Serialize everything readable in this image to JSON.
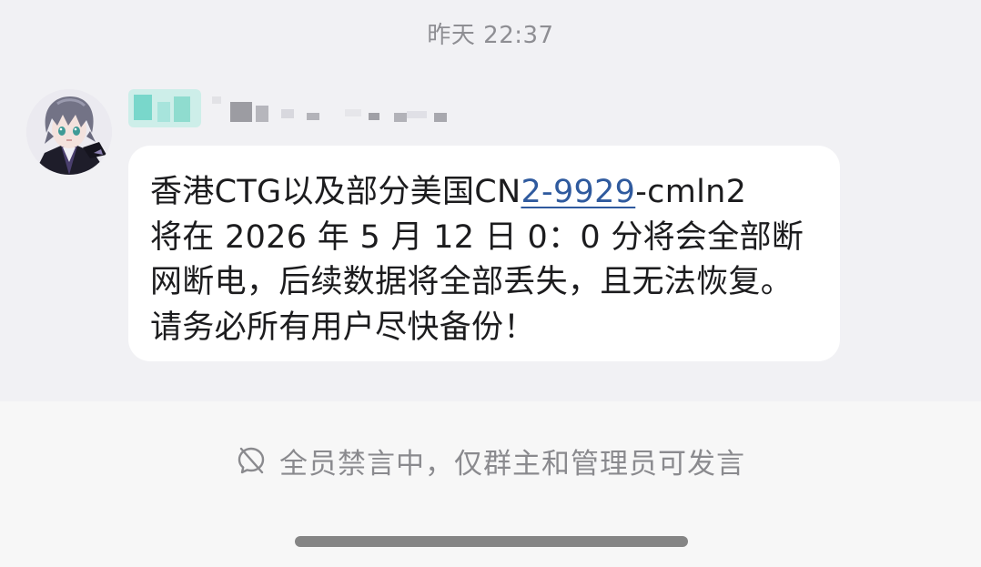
{
  "chat": {
    "timestamp": "昨天 22:37",
    "message": {
      "line1_before": "香港CTG以及部分美国CN",
      "line1_link": "2-9929",
      "line1_after": "-cmln2",
      "line2": "将在 2026 年 5 月 12 日 0：0 分将会全部断",
      "line3": "网断电，后续数据将全部丢失，且无法恢复。",
      "line4": "请务必所有用户尽快备份！"
    }
  },
  "footer": {
    "mute_notice": "全员禁言中，仅群主和管理员可发言"
  },
  "icons": {
    "mute": "chat-disabled-icon",
    "avatar": "anime-avatar"
  },
  "colors": {
    "link": "#2f5a9e",
    "bubble": "#ffffff",
    "chat_background": "#f1f1f4",
    "footer_background": "#f7f7f7"
  }
}
